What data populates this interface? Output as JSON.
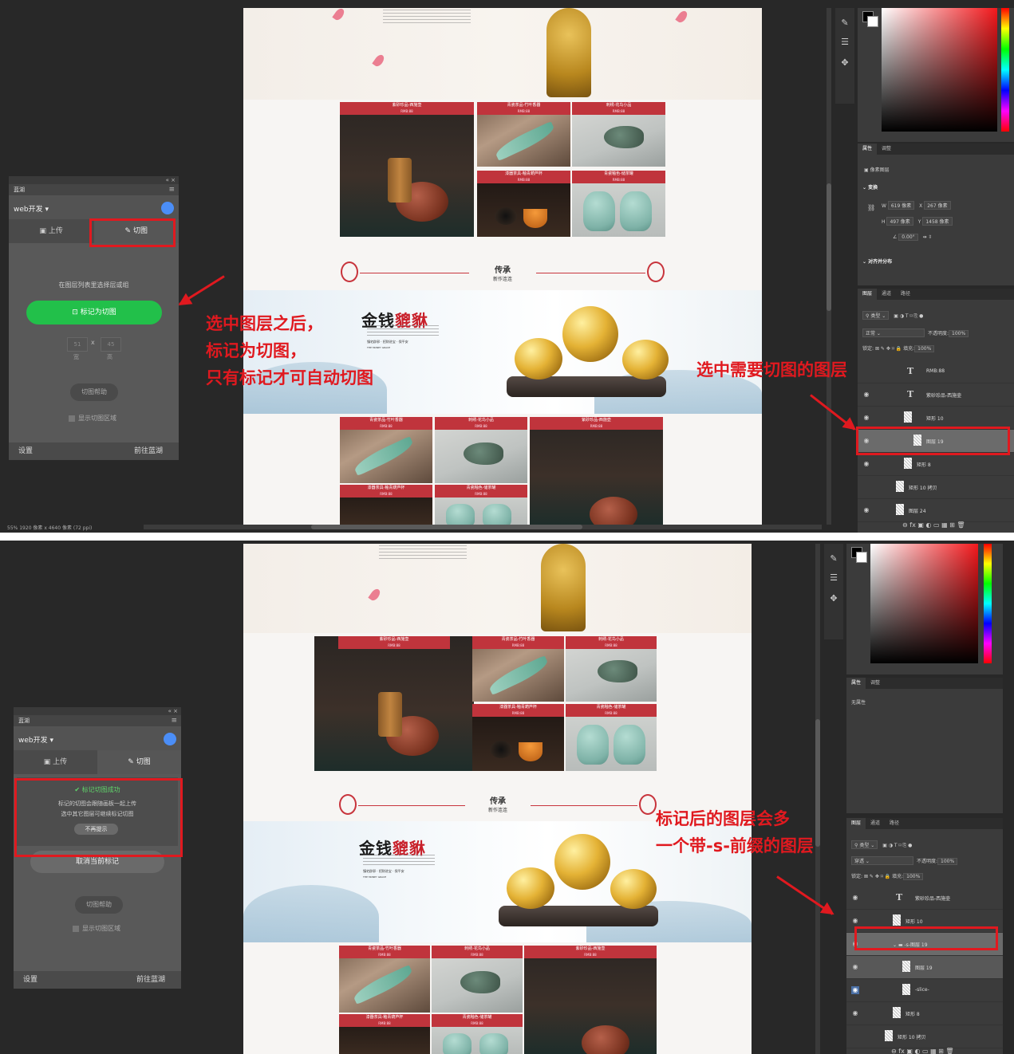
{
  "colors": {
    "accent_red": "#e0191f",
    "green": "#22c04a",
    "panel_bg": "#3b3b3b",
    "blue_dot": "#4b8ef7"
  },
  "screens": [
    {
      "lanhu": {
        "brand": "蓝湖",
        "project": "web开发",
        "tab_upload": "上传",
        "tab_slice": "切图",
        "hint": "在图层列表里选择层或组",
        "mark_button": "标记为切图",
        "width_label": "宽",
        "height_label": "高",
        "width_value": "51",
        "height_value": "45",
        "help_button": "切图帮助",
        "show_area": "显示切图区域",
        "settings": "设置",
        "go_lanhu": "前往蓝湖"
      },
      "annotations": {
        "left": [
          "选中图层之后，",
          "标记为切图，",
          "只有标记才可自动切图"
        ],
        "right": "选中需要切图的图层"
      },
      "status": "55%  1920 像素 x 4640 像素 (72 ppi)",
      "properties": {
        "tab_props": "属性",
        "tab_adjust": "调整",
        "type": "像素图层",
        "transform": "变换",
        "w_label": "W",
        "w": "619 像素",
        "x_label": "X",
        "x": "267 像素",
        "h_label": "H",
        "h": "497 像素",
        "y_label": "Y",
        "y": "1458 像素",
        "angle": "0.00°",
        "align": "对齐并分布"
      },
      "layers_panel": {
        "tab_layers": "图层",
        "tab_channels": "通道",
        "tab_paths": "路径",
        "filter": "类型",
        "blend": "正常",
        "opacity_label": "不透明度:",
        "opacity": "100%",
        "lock_label": "锁定:",
        "fill_label": "填充:",
        "fill": "100%",
        "items": [
          "RMB:88",
          "紫砂珍品-西施壶",
          "矩形 10",
          "图层 19",
          "矩形 8",
          "矩形 10 拷贝",
          "图层 24"
        ]
      }
    },
    {
      "lanhu": {
        "brand": "蓝湖",
        "project": "web开发",
        "tab_upload": "上传",
        "tab_slice": "切图",
        "success": "标记切图成功",
        "success_desc1": "标记的切图会跟随画板一起上传",
        "success_desc2": "选中其它图层可继续标记切图",
        "dismiss": "不再提示",
        "cancel_mark": "取消当前标记",
        "help_button": "切图帮助",
        "show_area": "显示切图区域",
        "settings": "设置",
        "go_lanhu": "前往蓝湖"
      },
      "annotations": {
        "right": [
          "标记后的图层会多",
          "一个带-s-前缀的图层"
        ]
      },
      "properties": {
        "tab_props": "属性",
        "tab_adjust": "调整",
        "none": "无属性"
      },
      "layers_panel": {
        "tab_layers": "图层",
        "tab_channels": "通道",
        "tab_paths": "路径",
        "filter": "类型",
        "blend": "穿透",
        "opacity_label": "不透明度:",
        "opacity": "100%",
        "lock_label": "锁定:",
        "fill_label": "填充:",
        "fill": "100%",
        "items": [
          "紫砂珍品-西施壶",
          "矩形 10",
          "-s-图层 19",
          "图层 19",
          "-slice-",
          "矩形 8",
          "矩形 10 拷贝"
        ]
      }
    }
  ],
  "webpage": {
    "products": [
      {
        "name": "紫砂珍品-西施壶",
        "price": "RMB:88"
      },
      {
        "name": "青瓷茶品-竹叶香器",
        "price": "RMB:88"
      },
      {
        "name": "刺绣-花鸟小品",
        "price": "RMB:88"
      },
      {
        "name": "漆器茶具-釉青葫芦杯",
        "price": "RMB:88"
      },
      {
        "name": "青瓷釉色-储茶罐",
        "price": "RMB:88"
      }
    ],
    "section_title": "传承",
    "section_subtitle": "新作连连",
    "banner_title_black": "金钱",
    "banner_title_red": "貔貅",
    "banner_slogan": "镇宅辟邪 · 招财进宝 · 保平安",
    "banner_en": "THE MONEY GRACE"
  }
}
